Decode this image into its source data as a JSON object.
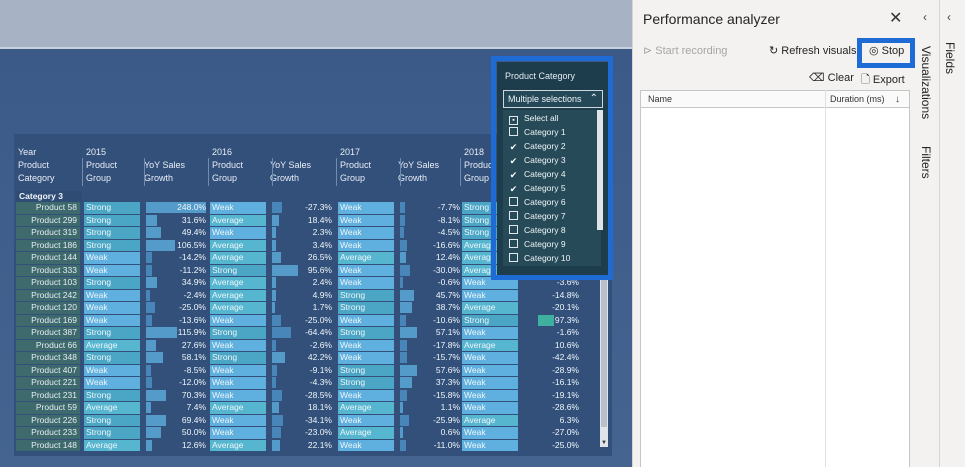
{
  "matrix": {
    "headers": {
      "year": "Year",
      "product_category": "Product Category",
      "years": [
        "2015",
        "2016",
        "2017",
        "2018"
      ],
      "product_group": "Product Group",
      "yoy": "YoY Sales Growth",
      "category_row": "Category 3"
    },
    "rows": [
      [
        "Product 58",
        "Strong",
        "248.0%",
        "Weak",
        "-27.3%",
        "Weak",
        "-7.7%",
        "Strong"
      ],
      [
        "Product 299",
        "Strong",
        "31.6%",
        "Average",
        "18.4%",
        "Weak",
        "-8.1%",
        "Strong"
      ],
      [
        "Product 319",
        "Strong",
        "49.4%",
        "Weak",
        "2.3%",
        "Weak",
        "-4.5%",
        "Strong"
      ],
      [
        "Product 186",
        "Strong",
        "106.5%",
        "Average",
        "3.4%",
        "Weak",
        "-16.6%",
        "Average"
      ],
      [
        "Product 144",
        "Weak",
        "-14.2%",
        "Average",
        "26.5%",
        "Average",
        "12.4%",
        "Average"
      ],
      [
        "Product 333",
        "Weak",
        "-11.2%",
        "Strong",
        "95.6%",
        "Weak",
        "-30.0%",
        "Average"
      ],
      [
        "Product 103",
        "Strong",
        "34.9%",
        "Average",
        "2.4%",
        "Weak",
        "-0.6%",
        "Weak"
      ],
      [
        "Product 242",
        "Weak",
        "-2.4%",
        "Average",
        "4.9%",
        "Strong",
        "45.7%",
        "Weak"
      ],
      [
        "Product 120",
        "Weak",
        "-25.0%",
        "Average",
        "1.7%",
        "Strong",
        "38.7%",
        "Average"
      ],
      [
        "Product 169",
        "Weak",
        "-13.6%",
        "Weak",
        "-25.0%",
        "Weak",
        "-10.6%",
        "Strong"
      ],
      [
        "Product 387",
        "Strong",
        "115.9%",
        "Strong",
        "-64.4%",
        "Strong",
        "57.1%",
        "Weak"
      ],
      [
        "Product 66",
        "Average",
        "27.6%",
        "Weak",
        "-2.6%",
        "Weak",
        "-17.8%",
        "Average"
      ],
      [
        "Product 348",
        "Strong",
        "58.1%",
        "Strong",
        "42.2%",
        "Weak",
        "-15.7%",
        "Weak"
      ],
      [
        "Product 407",
        "Weak",
        "-8.5%",
        "Weak",
        "-9.1%",
        "Strong",
        "57.6%",
        "Weak"
      ],
      [
        "Product 221",
        "Weak",
        "-12.0%",
        "Weak",
        "-4.3%",
        "Strong",
        "37.3%",
        "Weak"
      ],
      [
        "Product 231",
        "Strong",
        "70.3%",
        "Weak",
        "-28.5%",
        "Weak",
        "-15.8%",
        "Weak"
      ],
      [
        "Product 59",
        "Average",
        "7.4%",
        "Average",
        "18.1%",
        "Average",
        "1.1%",
        "Weak"
      ],
      [
        "Product 226",
        "Strong",
        "69.4%",
        "Weak",
        "-34.1%",
        "Weak",
        "-25.9%",
        "Average"
      ],
      [
        "Product 233",
        "Strong",
        "50.0%",
        "Weak",
        "-23.0%",
        "Average",
        "0.6%",
        "Weak"
      ],
      [
        "Product 148",
        "Average",
        "12.6%",
        "Average",
        "22.1%",
        "Weak",
        "-11.0%",
        "Weak"
      ]
    ],
    "yoy2018": [
      "",
      "",
      "",
      "",
      "",
      "-31.7%",
      "-3.6%",
      "-14.8%",
      "-20.1%",
      "97.3%",
      "-1.6%",
      "10.6%",
      "-42.4%",
      "-28.9%",
      "-16.1%",
      "-19.1%",
      "-28.6%",
      "6.3%",
      "-27.0%",
      "-25.0%"
    ]
  },
  "slicer": {
    "title": "Product Category",
    "dropdown_value": "Multiple selections",
    "options": [
      {
        "label": "Select all",
        "state": "partial"
      },
      {
        "label": "Category 1",
        "state": "off"
      },
      {
        "label": "Category 2",
        "state": "on"
      },
      {
        "label": "Category 3",
        "state": "on"
      },
      {
        "label": "Category 4",
        "state": "on"
      },
      {
        "label": "Category 5",
        "state": "on"
      },
      {
        "label": "Category 6",
        "state": "off"
      },
      {
        "label": "Category 7",
        "state": "off"
      },
      {
        "label": "Category 8",
        "state": "off"
      },
      {
        "label": "Category 9",
        "state": "off"
      },
      {
        "label": "Category 10",
        "state": "off"
      }
    ]
  },
  "performance": {
    "title": "Performance analyzer",
    "start_recording": "Start recording",
    "refresh_visuals": "Refresh visuals",
    "stop": "Stop",
    "clear": "Clear",
    "export": "Export",
    "col_name": "Name",
    "col_duration": "Duration (ms)"
  },
  "rail": {
    "visualizations": "Visualizations",
    "filters": "Filters",
    "fields": "Fields"
  },
  "colors": {
    "strong": "#4aa6c4",
    "average": "#56b6d0",
    "weak": "#5fb0de",
    "highlight": "#1e6bd6"
  }
}
